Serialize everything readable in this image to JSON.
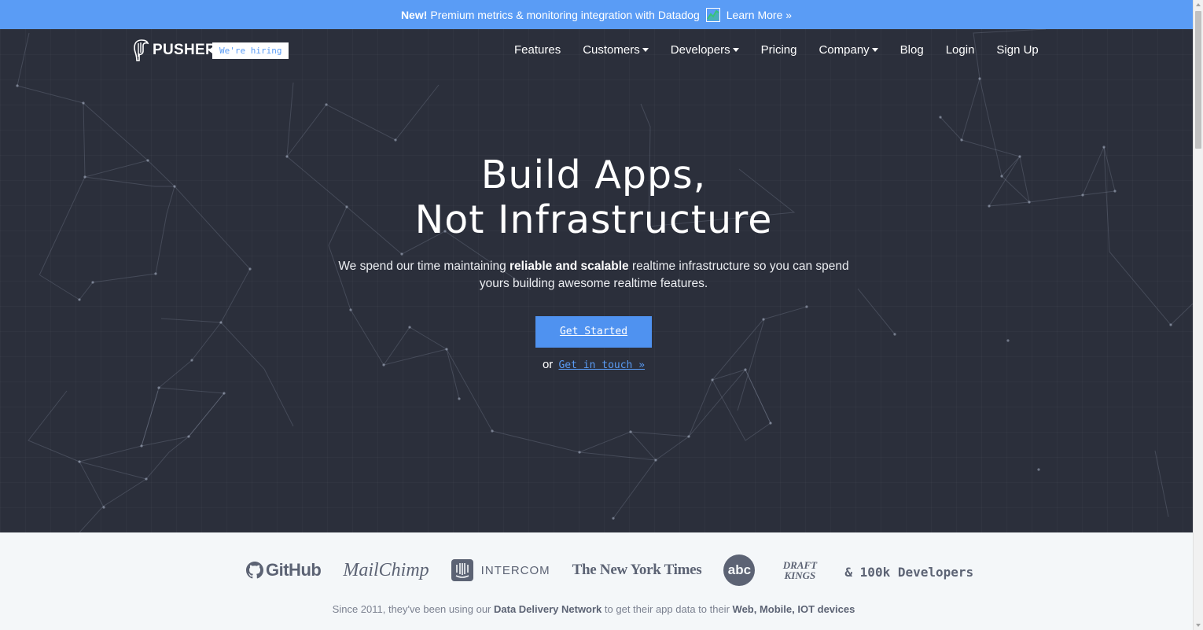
{
  "announcement": {
    "new_label": "New!",
    "message": "Premium metrics & monitoring integration with Datadog",
    "icon": "datadog-chart-icon",
    "link_label": "Learn More »"
  },
  "nav": {
    "brand": "PUSHER",
    "hiring_badge": "We're hiring",
    "items": [
      {
        "label": "Features",
        "dropdown": false
      },
      {
        "label": "Customers",
        "dropdown": true
      },
      {
        "label": "Developers",
        "dropdown": true
      },
      {
        "label": "Pricing",
        "dropdown": false
      },
      {
        "label": "Company",
        "dropdown": true
      },
      {
        "label": "Blog",
        "dropdown": false
      },
      {
        "label": "Login",
        "dropdown": false
      },
      {
        "label": "Sign Up",
        "dropdown": false
      }
    ]
  },
  "hero": {
    "title_line1": "Build Apps,",
    "title_line2": "Not Infrastructure",
    "subtitle_pre": "We spend our time maintaining",
    "subtitle_bold": "reliable and scalable",
    "subtitle_post": "realtime infrastructure so you can spend yours building awesome realtime features.",
    "cta_label": "Get Started",
    "or_label": "or",
    "secondary_link": "Get in touch »"
  },
  "clients": {
    "logos": [
      "GitHub",
      "MailChimp",
      "INTERCOM",
      "The New York Times",
      "abc",
      "DRAFT KINGS"
    ],
    "more_label": "& 100k Developers",
    "since_pre": "Since 2011, they've been using our",
    "since_bold1": "Data Delivery Network",
    "since_mid": "to get their app data to their",
    "since_bold2": "Web, Mobile, IOT devices"
  },
  "colors": {
    "accent": "#5a9cf5",
    "hero_bg": "#2b2f3b",
    "clients_bg": "#f4f7f9"
  }
}
